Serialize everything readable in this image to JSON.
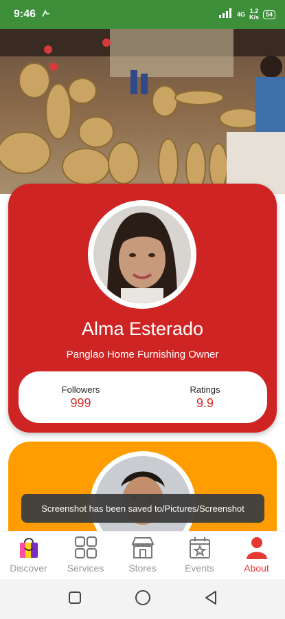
{
  "status_bar": {
    "time": "9:46",
    "left_icon": "notification-icon",
    "network_speed_top": "1.2",
    "network_speed_bottom": "K/s",
    "network_type": "4G",
    "battery": "54"
  },
  "banner": {
    "image_description_icon": "woven-baskets-photo"
  },
  "profile": {
    "name": "Alma Esterado",
    "role": "Panglao Home Furnishing Owner",
    "followers_label": "Followers",
    "followers_value": "999",
    "ratings_label": "Ratings",
    "ratings_value": "9.9"
  },
  "colors": {
    "status_bar": "#3d8f3a",
    "card_red": "#cf2424",
    "card_orange": "#ff9d00",
    "accent": "#e53935"
  },
  "toast": {
    "message": "Screenshot has been saved to/Pictures/Screenshot"
  },
  "bottom_nav": {
    "items": [
      {
        "label": "Discover",
        "icon": "shopping-bag-icon",
        "active": false
      },
      {
        "label": "Services",
        "icon": "grid-icon",
        "active": false
      },
      {
        "label": "Stores",
        "icon": "storefront-icon",
        "active": false
      },
      {
        "label": "Events",
        "icon": "calendar-star-icon",
        "active": false
      },
      {
        "label": "About",
        "icon": "person-icon",
        "active": true
      }
    ]
  },
  "system_nav": {
    "recents": "square-icon",
    "home": "circle-icon",
    "back": "triangle-back-icon"
  }
}
